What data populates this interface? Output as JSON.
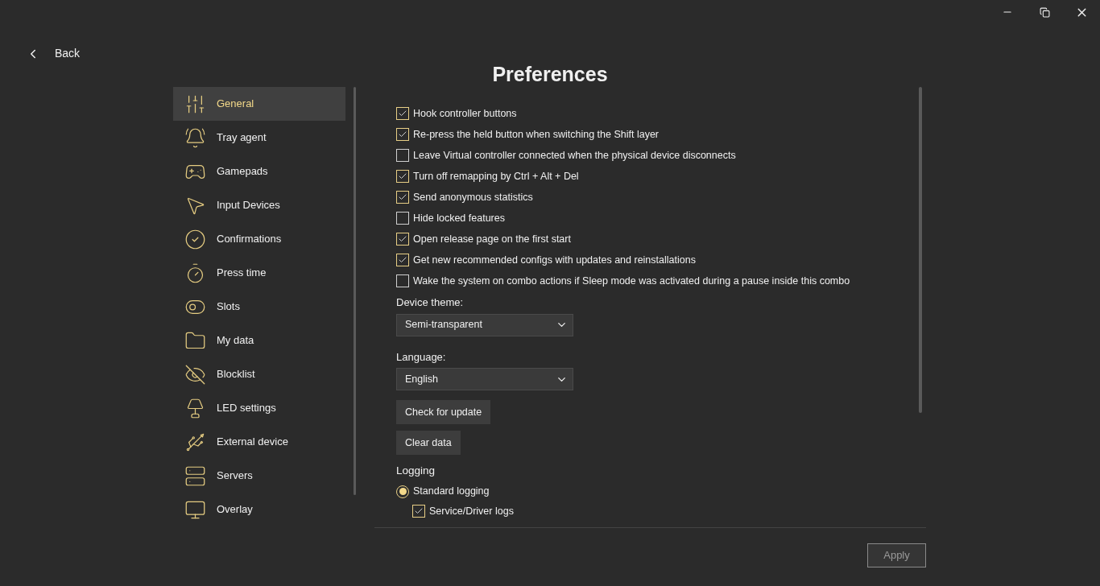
{
  "back": {
    "label": "Back"
  },
  "title": "Preferences",
  "sidebar": {
    "items": [
      {
        "label": "General",
        "selected": true
      },
      {
        "label": "Tray agent",
        "selected": false
      },
      {
        "label": "Gamepads",
        "selected": false
      },
      {
        "label": "Input Devices",
        "selected": false
      },
      {
        "label": "Confirmations",
        "selected": false
      },
      {
        "label": "Press time",
        "selected": false
      },
      {
        "label": "Slots",
        "selected": false
      },
      {
        "label": "My data",
        "selected": false
      },
      {
        "label": "Blocklist",
        "selected": false
      },
      {
        "label": "LED settings",
        "selected": false
      },
      {
        "label": "External device",
        "selected": false
      },
      {
        "label": "Servers",
        "selected": false
      },
      {
        "label": "Overlay",
        "selected": false
      }
    ]
  },
  "options": [
    {
      "label": "Hook controller buttons",
      "checked": true
    },
    {
      "label": "Re-press the held button when switching the Shift layer",
      "checked": true
    },
    {
      "label": "Leave Virtual controller connected when the physical device disconnects",
      "checked": false
    },
    {
      "label": "Turn off remapping by Ctrl + Alt + Del",
      "checked": true
    },
    {
      "label": "Send anonymous statistics",
      "checked": true
    },
    {
      "label": "Hide locked features",
      "checked": false
    },
    {
      "label": "Open release page on the first start",
      "checked": true
    },
    {
      "label": "Get new recommended configs with updates and reinstallations",
      "checked": true
    },
    {
      "label": "Wake the system on combo actions if Sleep mode was activated during a pause inside this combo",
      "checked": false
    }
  ],
  "dropdowns": [
    {
      "label": "Device theme:",
      "value": "Semi-transparent"
    },
    {
      "label": "Language:",
      "value": "English"
    }
  ],
  "buttons": [
    "Check for update",
    "Clear data"
  ],
  "logging": {
    "title": "Logging",
    "modes": [
      {
        "label": "Standard logging",
        "selected": true
      }
    ],
    "sub_options": [
      {
        "label": "Service/Driver logs",
        "checked": true
      }
    ]
  },
  "apply": {
    "label": "Apply",
    "disabled": true
  }
}
